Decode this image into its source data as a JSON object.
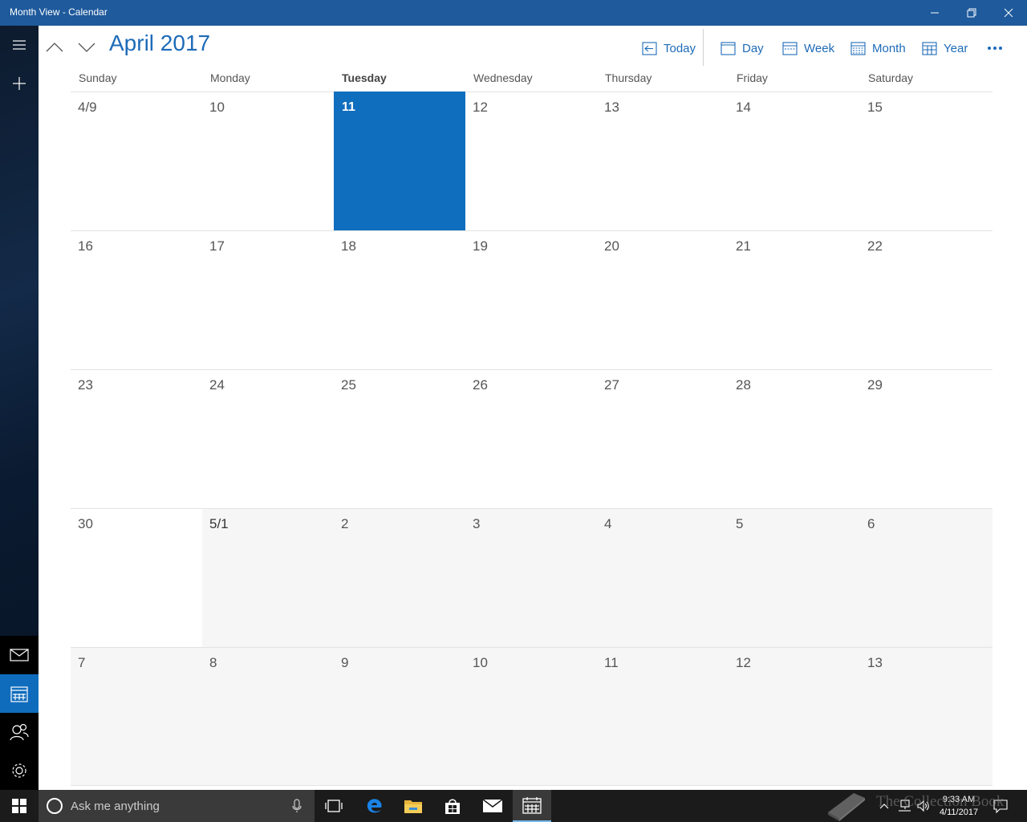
{
  "window": {
    "title": "Month View - Calendar"
  },
  "header": {
    "month_title": "April 2017",
    "commands": {
      "today": "Today",
      "day": "Day",
      "week": "Week",
      "month": "Month",
      "year": "Year"
    }
  },
  "calendar": {
    "weekdays": [
      "Sunday",
      "Monday",
      "Tuesday",
      "Wednesday",
      "Thursday",
      "Friday",
      "Saturday"
    ],
    "today_weekday": "Tuesday",
    "today_date": "4/11/2017",
    "weeks": [
      [
        "4/9",
        "10",
        "11",
        "12",
        "13",
        "14",
        "15"
      ],
      [
        "16",
        "17",
        "18",
        "19",
        "20",
        "21",
        "22"
      ],
      [
        "23",
        "24",
        "25",
        "26",
        "27",
        "28",
        "29"
      ],
      [
        "30",
        "5/1",
        "2",
        "3",
        "4",
        "5",
        "6"
      ],
      [
        "7",
        "8",
        "9",
        "10",
        "11",
        "12",
        "13"
      ]
    ]
  },
  "taskbar": {
    "search_placeholder": "Ask me anything",
    "time": "9:33 AM",
    "date": "4/11/2017"
  },
  "watermark": "The Collection Book",
  "colors": {
    "titlebar": "#1e5a9c",
    "accent": "#106ebe",
    "link": "#1e6bb8",
    "next_month_cell": "#f6f6f6"
  }
}
